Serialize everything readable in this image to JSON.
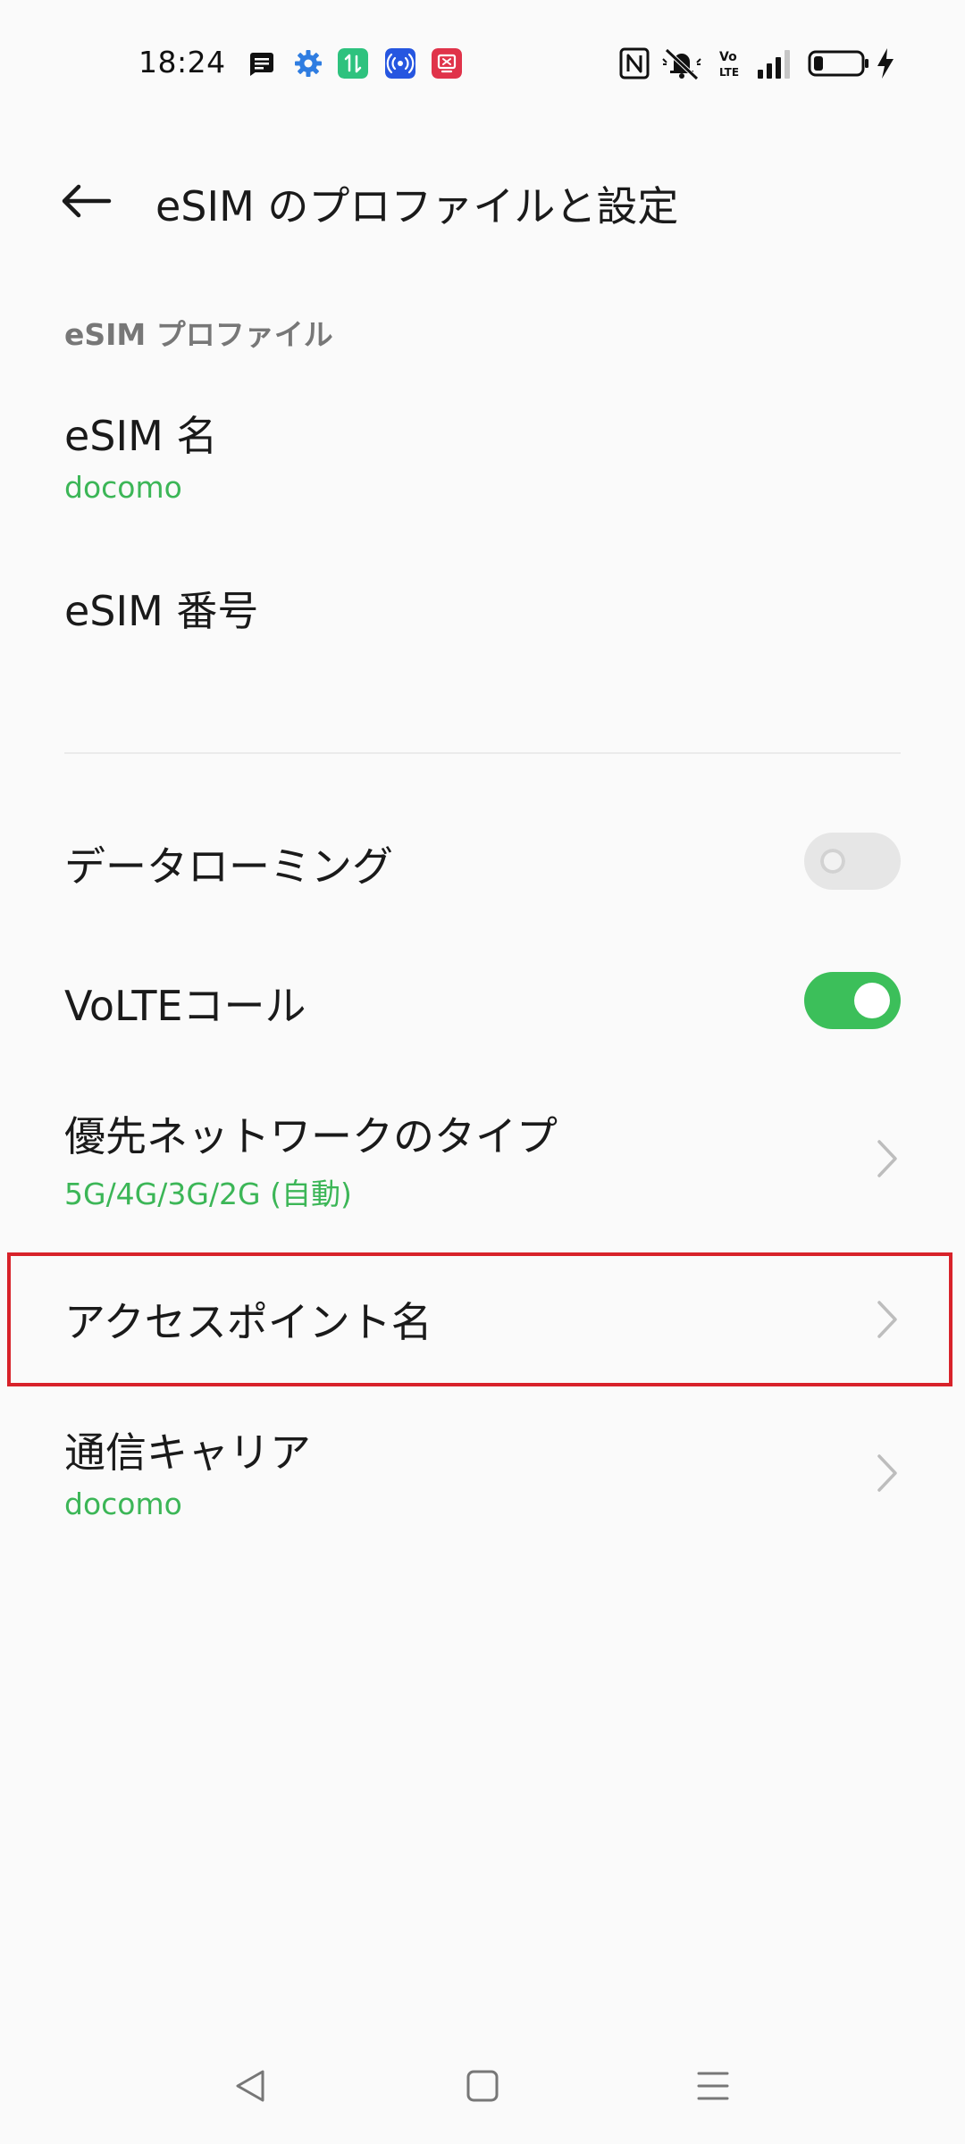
{
  "status_bar": {
    "time": "18:24",
    "notification_icons": [
      "message-icon",
      "settings-gear-icon",
      "data-transfer-icon",
      "hotspot-icon",
      "screen-record-icon"
    ],
    "system_icons": [
      "nfc-icon",
      "mute-icon",
      "volte-icon",
      "signal-icon",
      "battery-icon",
      "charging-icon"
    ],
    "battery_level": 0.2
  },
  "header": {
    "title": "eSIM のプロファイルと設定",
    "back_icon": "back-arrow-icon"
  },
  "section": {
    "label": "eSIM プロファイル"
  },
  "profile": {
    "name_title": "eSIM 名",
    "name_value": "docomo",
    "number_title": "eSIM 番号"
  },
  "settings": {
    "roaming": {
      "label": "データローミング",
      "enabled": false
    },
    "volte": {
      "label": "VoLTEコール",
      "enabled": true
    },
    "network_type": {
      "label": "優先ネットワークのタイプ",
      "value": "5G/4G/3G/2G (自動)"
    },
    "apn": {
      "label": "アクセスポイント名"
    },
    "carrier": {
      "label": "通信キャリア",
      "value": "docomo"
    }
  },
  "nav_bar": {
    "icons": [
      "nav-back-icon",
      "nav-home-icon",
      "nav-menu-icon"
    ]
  },
  "colors": {
    "accent": "#3cb657",
    "toggle_on": "#3cbf5a",
    "highlight": "#d8222a"
  }
}
